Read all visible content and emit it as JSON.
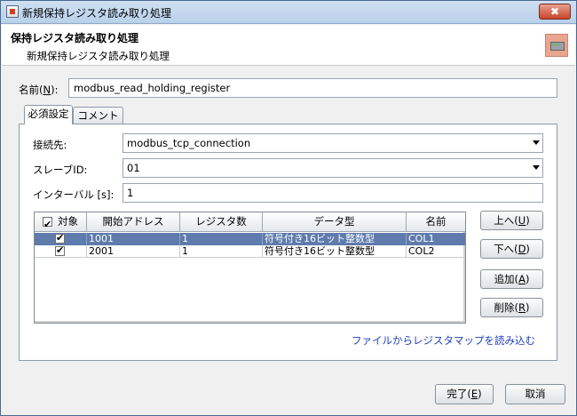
{
  "window": {
    "title": "新規保持レジスタ読み取り処理",
    "close_label": "✖"
  },
  "header": {
    "title": "保持レジスタ読み取り処理",
    "subtitle": "新規保持レジスタ読み取り処理",
    "icon": "device-icon"
  },
  "name": {
    "label_prefix": "名前(",
    "label_key": "N",
    "label_suffix": "):",
    "value": "modbus_read_holding_register"
  },
  "tabs": [
    {
      "label": "必須設定",
      "active": true
    },
    {
      "label": "コメント",
      "active": false
    }
  ],
  "form": {
    "connection_label": "接続先:",
    "connection_value": "modbus_tcp_connection",
    "slave_label": "スレーブID:",
    "slave_value": "01",
    "interval_label": "インターバル [s]:",
    "interval_value": "1"
  },
  "table": {
    "headers": [
      "対象",
      "開始アドレス",
      "レジスタ数",
      "データ型",
      "名前"
    ],
    "rows": [
      {
        "checked": true,
        "address": "1001",
        "count": "1",
        "type": "符号付き16ビット整数型",
        "name": "COL1",
        "selected": true
      },
      {
        "checked": true,
        "address": "2001",
        "count": "1",
        "type": "符号付き16ビット整数型",
        "name": "COL2",
        "selected": false
      }
    ]
  },
  "buttons": {
    "up": {
      "text": "上へ(",
      "key": "U",
      "end": ")"
    },
    "down": {
      "text": "下へ(",
      "key": "D",
      "end": ")"
    },
    "add": {
      "text": "追加(",
      "key": "A",
      "end": ")"
    },
    "delete": {
      "text": "削除(",
      "key": "R",
      "end": ")"
    },
    "finish": {
      "text": "完了(",
      "key": "E",
      "end": ")"
    },
    "cancel": "取消"
  },
  "link": "ファイルからレジスタマップを読み込む",
  "colors": {
    "selection": "#5f7bac",
    "link": "#1f3fbf",
    "close": "#c8442a"
  }
}
